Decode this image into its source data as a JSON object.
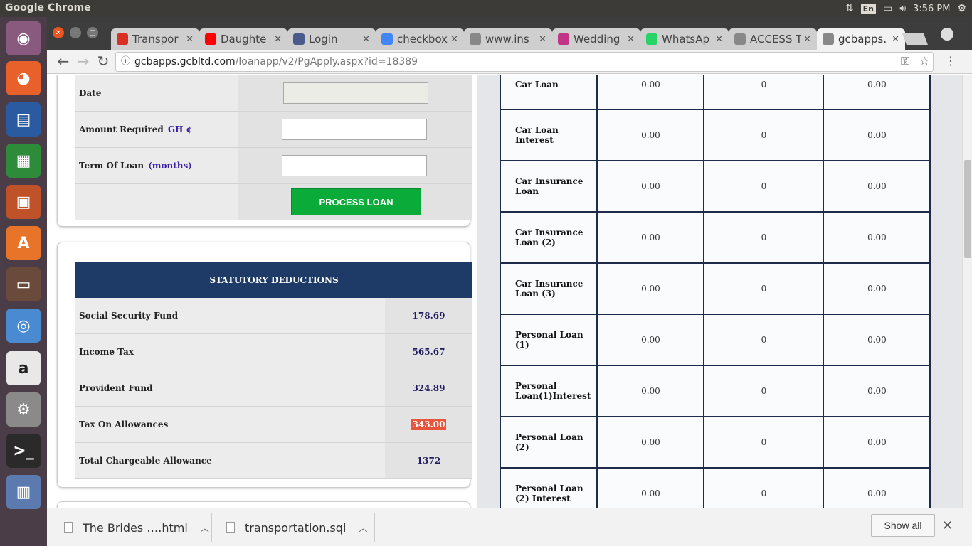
{
  "top_panel": {
    "app_title": "Google Chrome",
    "lang": "En",
    "clock": "3:56 PM"
  },
  "tabs": [
    {
      "title": "Transpor",
      "favicon": "gmail-icon",
      "color": "#d93025"
    },
    {
      "title": "Daughte",
      "favicon": "youtube-icon",
      "color": "#ff0000"
    },
    {
      "title": "Login",
      "favicon": "layers-icon",
      "color": "#4a5a8a"
    },
    {
      "title": "checkbox",
      "favicon": "google-icon",
      "color": "#4285f4"
    },
    {
      "title": "www.ins",
      "favicon": "document-icon",
      "color": "#888888"
    },
    {
      "title": "Wedding",
      "favicon": "instagram-icon",
      "color": "#c13584"
    },
    {
      "title": "WhatsAp",
      "favicon": "whatsapp-icon",
      "color": "#25d366"
    },
    {
      "title": "ACCESS T",
      "favicon": "document-icon",
      "color": "#888888"
    },
    {
      "title": "gcbapps.",
      "favicon": "document-icon",
      "color": "#888888"
    }
  ],
  "address_bar": {
    "domain": "gcbapps.gcbltd.com",
    "path": "/loanapp/v2/PgApply.aspx?id=18389"
  },
  "loan_form": {
    "date_label": "Date",
    "amount_label": "Amount Required",
    "amount_unit": "GH ¢",
    "term_label": "Term Of Loan",
    "term_unit": "(months)",
    "process_button": "PROCESS LOAN"
  },
  "statutory": {
    "header": "STATUTORY DEDUCTIONS",
    "rows": [
      {
        "label": "Social Security Fund",
        "value": "178.69"
      },
      {
        "label": "Income Tax",
        "value": "565.67"
      },
      {
        "label": "Provident Fund",
        "value": "324.89"
      },
      {
        "label": "Tax On Allowances",
        "value": "343.00"
      },
      {
        "label": "Total Chargeable Allowance",
        "value": "1372"
      }
    ]
  },
  "loans": [
    {
      "name": "Car Loan",
      "a": "0.00",
      "b": "0",
      "c": "0.00"
    },
    {
      "name": "Car Loan Interest",
      "a": "0.00",
      "b": "0",
      "c": "0.00"
    },
    {
      "name": "Car Insurance Loan",
      "a": "0.00",
      "b": "0",
      "c": "0.00"
    },
    {
      "name": "Car Insurance Loan (2)",
      "a": "0.00",
      "b": "0",
      "c": "0.00"
    },
    {
      "name": "Car Insurance Loan (3)",
      "a": "0.00",
      "b": "0",
      "c": "0.00"
    },
    {
      "name": "Personal Loan (1)",
      "a": "0.00",
      "b": "0",
      "c": "0.00"
    },
    {
      "name": "Personal Loan(1)Interest",
      "a": "0.00",
      "b": "0",
      "c": "0.00"
    },
    {
      "name": "Personal Loan (2)",
      "a": "0.00",
      "b": "0",
      "c": "0.00"
    },
    {
      "name": "Personal Loan (2) Interest",
      "a": "0.00",
      "b": "0",
      "c": "0.00"
    }
  ],
  "downloads": {
    "items": [
      "The Brides ….html",
      "transportation.sql"
    ],
    "show_all": "Show all"
  }
}
